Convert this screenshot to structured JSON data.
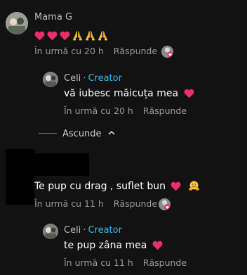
{
  "comments": [
    {
      "username": "Mama G",
      "text_emojis": [
        "heart",
        "heart",
        "heart",
        "pray",
        "pray",
        "pray"
      ],
      "time": "În urmă cu 20 h",
      "reply_label": "Răspunde"
    },
    {
      "username": "Celi",
      "creator_label": "Creator",
      "text": "vă iubesc măicuța mea",
      "time": "În urmă cu 20 h",
      "reply_label": "Răspunde"
    },
    {
      "hide_label": "Ascunde"
    },
    {
      "text": "Te pup cu drag , suflet bun",
      "time": "În urmă cu 11 h",
      "reply_label": "Răspunde"
    },
    {
      "username": "Celi",
      "creator_label": "Creator",
      "text": "te pup zâna mea",
      "time": "În urmă cu 11 h",
      "reply_label": "Răspunde"
    }
  ],
  "colors": {
    "background": "#121212",
    "creator": "#2fb8f0",
    "heart": "#ee2e6b",
    "muted": "#9a9a9a"
  }
}
